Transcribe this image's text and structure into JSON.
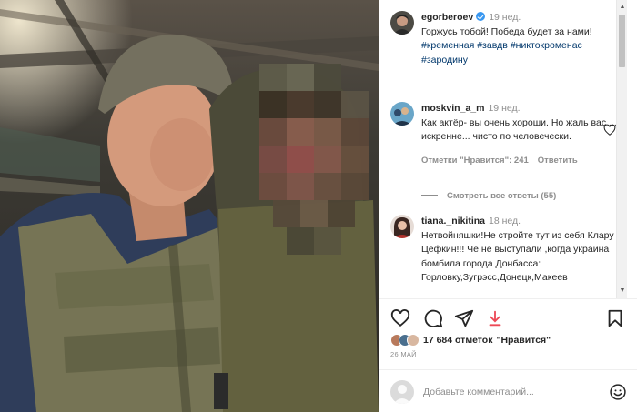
{
  "post": {
    "author": {
      "username": "egorberoev",
      "verified": true,
      "time": "19 нед.",
      "text": "Горжусь тобой! Победа будет за нами!",
      "hashtags": [
        "#кременная",
        "#завдв",
        "#никтокроменас",
        "#зародину"
      ]
    },
    "comments": [
      {
        "username": "moskvin_a_m",
        "time": "19 нед.",
        "text": "Как актёр- вы очень хороши. Но жаль вас ... искренне... чисто по человечески.",
        "likes_label": "Отметки \"Нравится\": 241",
        "reply_label": "Ответить",
        "view_replies": "Смотреть все ответы (55)"
      },
      {
        "username": "tiana._nikitina",
        "time": "18 нед.",
        "text": "Нетвойняшки!Не стройте тут из себя Клару Цефкин!!! Чё не выступали ,когда украина бомбила города Донбасса: Горловку,Зугрэсс,Донецк,Макеев"
      }
    ],
    "likes_count": "17 684 отметок",
    "likes_word": "\"Нравится\"",
    "date": "26 МАЙ",
    "comment_placeholder": "Добавьте комментарий...",
    "icons": {
      "like": "heart-icon",
      "comment": "comment-icon",
      "share": "paper-plane-icon",
      "download": "download-arrow-icon",
      "save": "bookmark-icon",
      "emoji": "smiley-icon"
    },
    "colors": {
      "link": "#00376b",
      "secondary": "#8e8e8e",
      "verified": "#3897f0",
      "download_arrow": "#ed4956"
    }
  }
}
